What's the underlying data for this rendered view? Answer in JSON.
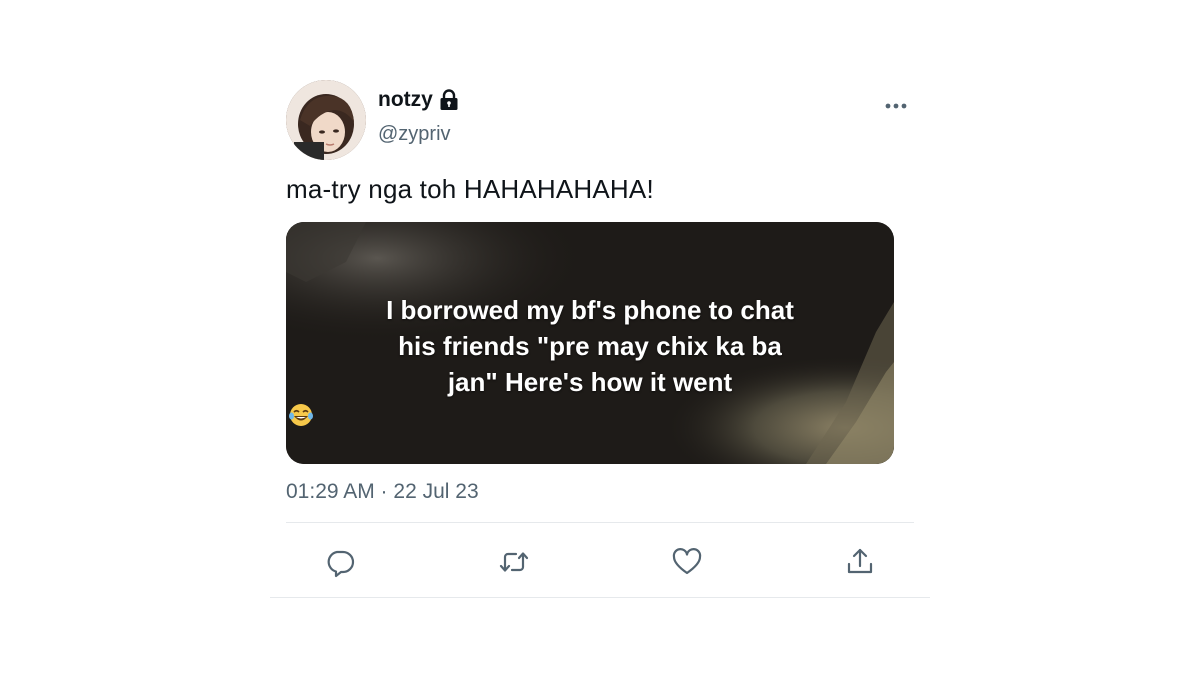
{
  "tweet": {
    "author": {
      "display_name": "notzy",
      "handle": "@zypriv",
      "protected_icon": "lock-icon",
      "avatar": "profile-photo"
    },
    "more_icon": "more-horizontal-icon",
    "text": "ma-try nga toh HAHAHAHAHA!",
    "media": {
      "caption_lines": [
        "I borrowed my bf's phone to chat",
        "his friends \"pre may chix ka ba",
        "jan\" Here's how it went"
      ],
      "emoji": "face-with-tears-of-joy"
    },
    "timestamp": "01:29 AM · 22 Jul 23",
    "actions": [
      {
        "name": "reply",
        "icon": "reply-icon"
      },
      {
        "name": "retweet",
        "icon": "retweet-icon"
      },
      {
        "name": "like",
        "icon": "heart-icon"
      },
      {
        "name": "share",
        "icon": "share-icon"
      }
    ],
    "colors": {
      "text_primary": "#0f1419",
      "text_secondary": "#536471",
      "icon": "#536471",
      "divider": "#e6e9ec"
    }
  }
}
